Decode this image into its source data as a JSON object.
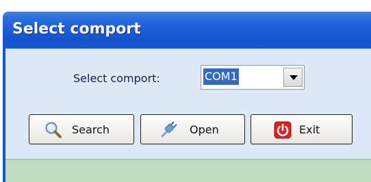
{
  "window": {
    "title": "Select comport"
  },
  "form": {
    "comport_label": "Select comport:",
    "comport_value": "COM1"
  },
  "buttons": {
    "search_label": "Search",
    "open_label": "Open",
    "exit_label": "Exit"
  },
  "icons": {
    "search": "magnifier-icon",
    "open": "plug-icon",
    "exit": "power-icon",
    "dropdown": "chevron-down-icon"
  },
  "colors": {
    "titlebar": "#1d5ed6",
    "client_background": "#dde9f7",
    "selection": "#316ac5",
    "statusbar": "#c0dcc0",
    "exit_icon": "#e02020"
  }
}
